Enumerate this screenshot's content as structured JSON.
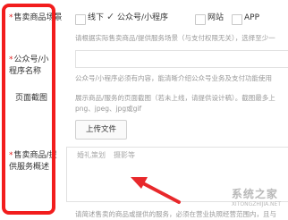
{
  "form": {
    "scene": {
      "label": "售卖商品场景",
      "options": [
        "线下",
        "公众号/小程序",
        "网站",
        "APP"
      ],
      "checked": [
        false,
        true,
        false,
        false
      ],
      "hint": "请根据实际售卖商品/提供服务场景（与支付权限无关），选择至少一"
    },
    "mp_name": {
      "label": "公众号/小程序名称",
      "hint": "公众号/小程序必须有内容，能清晰介绍公众号业务及支付功能使用"
    },
    "screenshot": {
      "label": "页面截图",
      "hint_line1": "展示商品/服务的页面截图（若未上线，请提供设计稿）。截图最多上",
      "hint_line2": "png、jpeg、jpg或gif",
      "upload_label": "上传文件"
    },
    "description": {
      "label": "售卖商品/提供服务概述",
      "placeholder_tabs": [
        "婚礼策划",
        "摄影等"
      ],
      "hint": "请简述售卖的商品或提供的服务，必须在营业执照经营范围内，且与"
    }
  },
  "watermark": {
    "text": "系统之家",
    "sub": "XITONGZHIJIA.NET"
  },
  "colors": {
    "highlight": "#f21d1d",
    "arrow": "#e8282b"
  }
}
